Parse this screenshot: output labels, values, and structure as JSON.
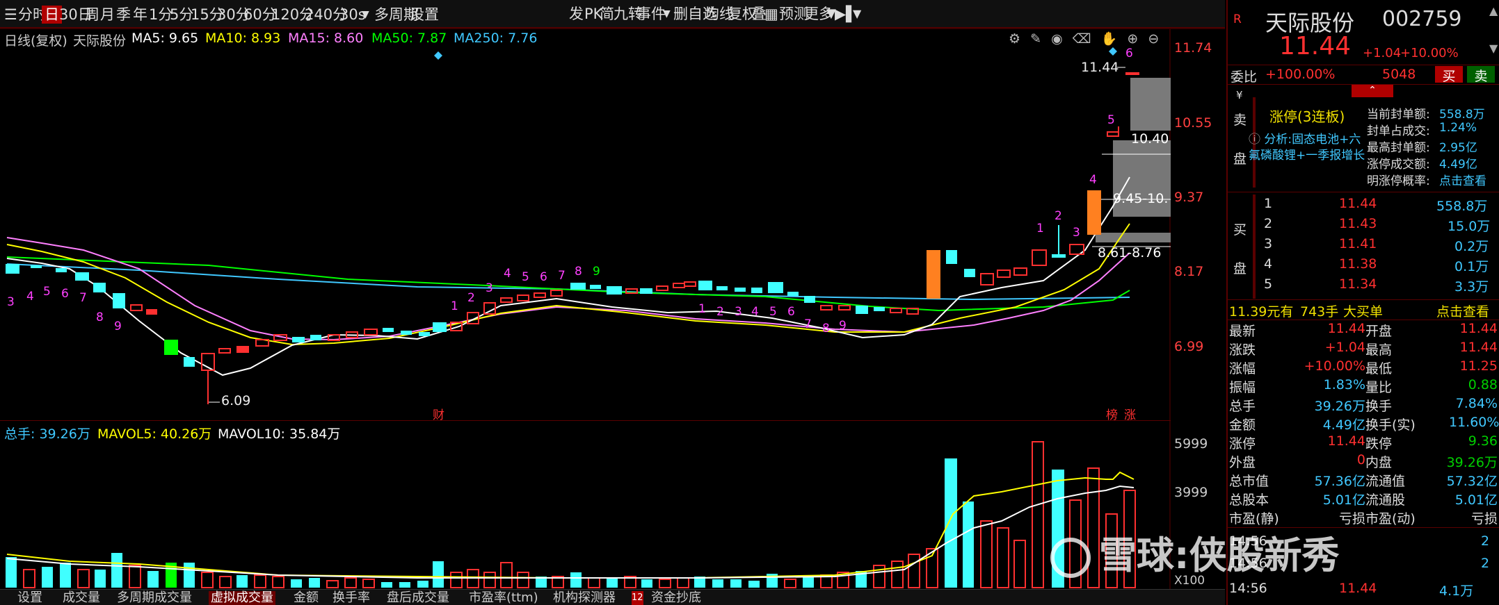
{
  "toolbar": {
    "items": [
      "分时",
      "日",
      "30日",
      "周",
      "月",
      "季",
      "年",
      "1分",
      "5分",
      "15分",
      "30分",
      "60分",
      "120分",
      "240分",
      "30s",
      "多周期",
      "设置"
    ],
    "right_items": [
      "发",
      "PK",
      "简",
      "九转",
      "事件",
      "删自选",
      "均线",
      "复权",
      "叠",
      "预测",
      "更多"
    ]
  },
  "main_chart": {
    "legend": {
      "period": "日线(复权)",
      "stock": "天际股份",
      "ma5": "MA5: 9.65",
      "ma10": "MA10: 8.93",
      "ma15": "MA15: 8.60",
      "ma50": "MA50: 7.87",
      "ma250": "MA250: 7.76"
    },
    "y_labels": [
      "11.74",
      "10.55",
      "9.37",
      "8.17",
      "6.99"
    ],
    "annotations": {
      "high": "11.44",
      "low": "6.09",
      "zone1": "10.40",
      "zone2": "9.45-10.",
      "zone3": "8.61-8.76",
      "cai": "财",
      "bang": "榜",
      "zhang": "涨"
    }
  },
  "volume_chart": {
    "legend": {
      "total": "总手: 39.26万",
      "mavol5": "MAVOL5: 40.26万",
      "mavol10": "MAVOL10: 35.84万"
    },
    "y_labels": [
      "5999",
      "3999"
    ],
    "unit": "X100"
  },
  "bottom_tabs": [
    "设置",
    "成交量",
    "多周期成交量",
    "虚拟成交量",
    "金额",
    "换手率",
    "盘后成交量",
    "市盈率(ttm)",
    "机构探测器",
    "资金抄底"
  ],
  "quote": {
    "name": "天际股份",
    "code": "002759",
    "price": "11.44",
    "change": "+1.04",
    "change_pct": "+10.00%",
    "weibi_label": "委比",
    "weibi": "+100.00%",
    "weibi_num": "5048",
    "buy_btn": "买",
    "sell_btn": "卖",
    "limit_title": "涨停(3连板)",
    "analysis": "分析:固态电池+六氟磷酸锂+一季报增长",
    "stats": [
      {
        "label": "当前封单额:",
        "value": "558.8万"
      },
      {
        "label": "封单占成交:",
        "value": "1.24%"
      },
      {
        "label": "最高封单额:",
        "value": "2.95亿"
      },
      {
        "label": "涨停成交额:",
        "value": "4.49亿"
      },
      {
        "label": "明涨停概率:",
        "value": "点击查看"
      }
    ],
    "sell_side": [
      "卖",
      "盘"
    ],
    "buy_side": [
      "买",
      "盘"
    ],
    "bids": [
      {
        "lvl": "1",
        "price": "11.44",
        "vol": "558.8万"
      },
      {
        "lvl": "2",
        "price": "11.43",
        "vol": "15.0万"
      },
      {
        "lvl": "3",
        "price": "11.41",
        "vol": "0.2万"
      },
      {
        "lvl": "4",
        "price": "11.38",
        "vol": "0.1万"
      },
      {
        "lvl": "5",
        "price": "11.34",
        "vol": "3.3万"
      }
    ],
    "bigorder": {
      "a": "11.39元有",
      "b": "743手",
      "c": "大买单",
      "d": "点击查看"
    },
    "table": [
      {
        "l1": "最新",
        "v1": "11.44",
        "l2": "开盘",
        "v2": "11.44"
      },
      {
        "l1": "涨跌",
        "v1": "+1.04",
        "l2": "最高",
        "v2": "11.44"
      },
      {
        "l1": "涨幅",
        "v1": "+10.00%",
        "l2": "最低",
        "v2": "11.25"
      },
      {
        "l1": "振幅",
        "v1": "1.83%",
        "l2": "量比",
        "v2": "0.88"
      },
      {
        "l1": "总手",
        "v1": "39.26万",
        "l2": "换手",
        "v2": "7.84%"
      },
      {
        "l1": "金额",
        "v1": "4.49亿",
        "l2": "换手(实)",
        "v2": "11.60%"
      },
      {
        "l1": "涨停",
        "v1": "11.44",
        "l2": "跌停",
        "v2": "9.36"
      },
      {
        "l1": "外盘",
        "v1": "0",
        "l2": "内盘",
        "v2": "39.26万"
      },
      {
        "l1": "总市值",
        "v1": "57.36亿",
        "l2": "流通值",
        "v2": "57.32亿"
      },
      {
        "l1": "总股本",
        "v1": "5.01亿",
        "l2": "流通股",
        "v2": "5.01亿"
      },
      {
        "l1": "市盈(静)",
        "v1": "亏损",
        "l2": "市盈(动)",
        "v2": "亏损"
      }
    ],
    "ticks": [
      {
        "t": "14:56",
        "p": "",
        "v": "2"
      },
      {
        "t": "14:56",
        "p": "",
        "v": "2"
      },
      {
        "t": "14:56",
        "p": "11.44",
        "v": "4.1万"
      }
    ]
  },
  "watermark": "雪球:侠股新秀",
  "colors": {
    "up": "#ff3030",
    "down": "#40ffff",
    "ma5": "#ffffff",
    "ma10": "#ffff00",
    "ma15": "#ff80ff",
    "ma50": "#00ff00",
    "ma250": "#40c8ff"
  }
}
